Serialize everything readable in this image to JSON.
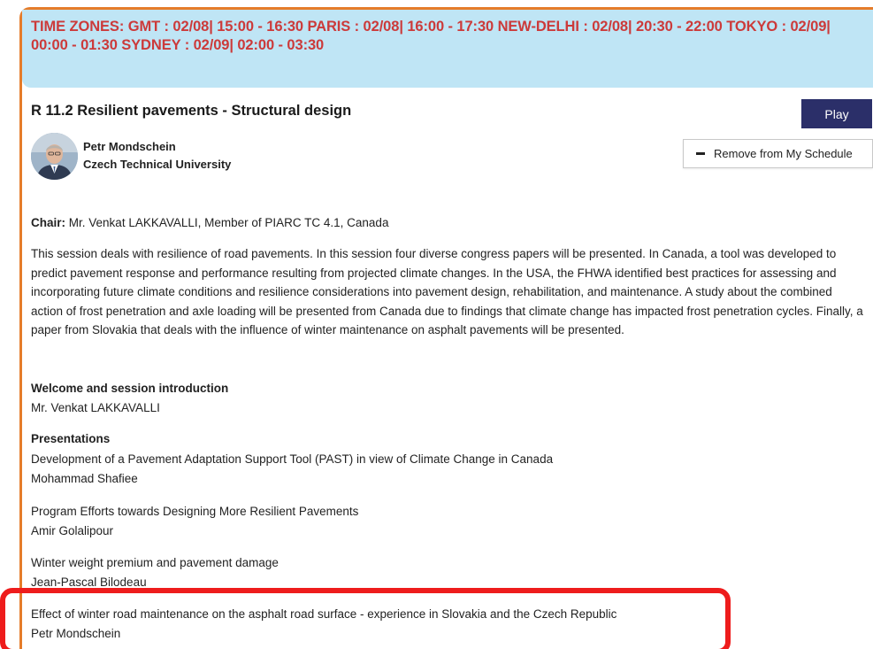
{
  "banner": {
    "timezones": "TIME ZONES: GMT : 02/08| 15:00 - 16:30 PARIS : 02/08| 16:00 - 17:30 NEW-DELHI : 02/08| 20:30 - 22:00 TOKYO : 02/09| 00:00 - 01:30 SYDNEY : 02/09| 02:00 - 03:30"
  },
  "session": {
    "title": "R 11.2 Resilient pavements - Structural design",
    "play_label": "Play",
    "remove_label": "Remove from My Schedule"
  },
  "speaker": {
    "name": "Petr Mondschein",
    "organization": "Czech Technical University"
  },
  "chair": {
    "label": "Chair:",
    "value": "Mr. Venkat LAKKAVALLI, Member of PIARC TC 4.1, Canada"
  },
  "description": "This session deals with resilience of road pavements. In this session four diverse congress papers will be presented. In Canada, a tool was developed to predict pavement response and performance resulting from projected climate changes. In the USA, the FHWA identified best practices for assessing and incorporating future climate conditions and resilience considerations into pavement design, rehabilitation, and maintenance. A study about the combined action of frost penetration and axle loading will be presented from Canada due to findings that climate change has impacted frost penetration cycles. Finally, a paper from Slovakia that deals with the influence of winter maintenance on asphalt pavements will be presented.",
  "welcome": {
    "heading": "Welcome and session introduction",
    "presenter": "Mr. Venkat LAKKAVALLI"
  },
  "presentations": {
    "heading": "Presentations",
    "items": [
      {
        "title": "Development of a Pavement Adaptation Support Tool (PAST) in view of Climate Change in Canada",
        "author": "Mohammad Shafiee"
      },
      {
        "title": "Program Efforts towards Designing More Resilient Pavements",
        "author": "Amir Golalipour"
      },
      {
        "title": "Winter weight premium and pavement damage",
        "author": "Jean-Pascal Bilodeau"
      },
      {
        "title": "Effect of winter road maintenance on the asphalt road surface - experience in Slovakia and the Czech Republic",
        "author": "Petr Mondschein"
      }
    ]
  },
  "colors": {
    "banner_bg": "#bfe5f5",
    "banner_text": "#cc3a3a",
    "frame_accent": "#e57c2a",
    "play_bg": "#2b2f69",
    "highlight": "#ee1c1c"
  }
}
